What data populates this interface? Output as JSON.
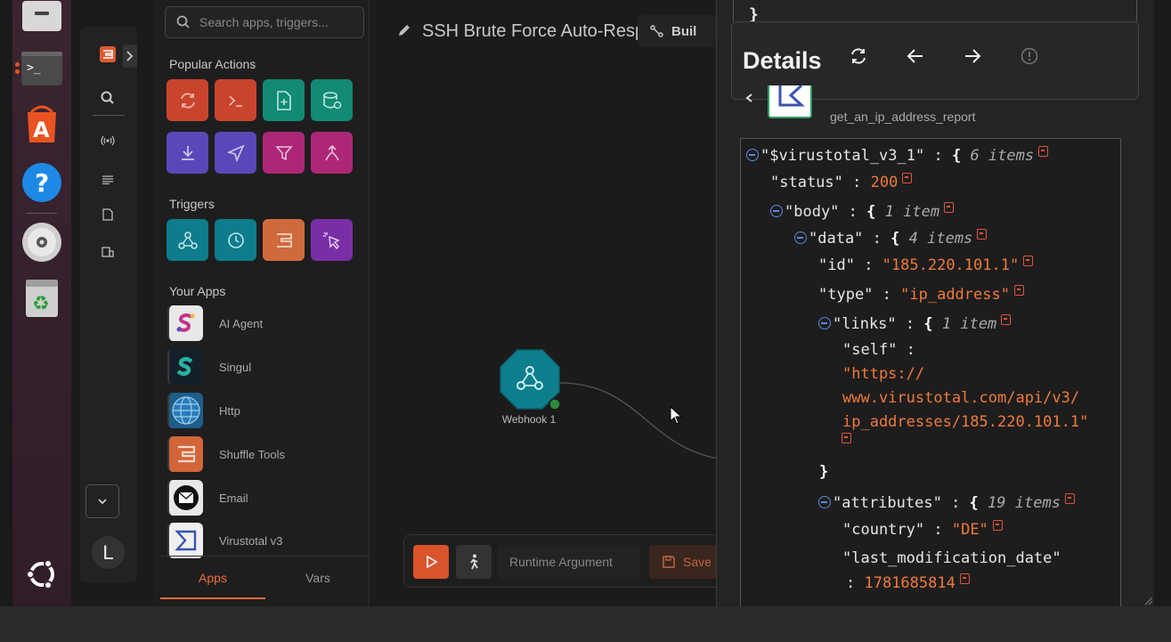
{
  "dock": {
    "apps": [
      {
        "name": "files-icon"
      },
      {
        "name": "terminal-icon",
        "label": ">_"
      },
      {
        "name": "app-center-icon"
      },
      {
        "name": "help-icon",
        "label": "?"
      },
      {
        "name": "disc-icon"
      },
      {
        "name": "trash-icon"
      },
      {
        "name": "ubuntu-logo-icon"
      }
    ]
  },
  "rail": {
    "avatar_letter": "L"
  },
  "apps_panel": {
    "search_placeholder": "Search apps, triggers...",
    "popular_actions_title": "Popular Actions",
    "triggers_title": "Triggers",
    "your_apps_title": "Your Apps",
    "apps": [
      {
        "name": "AI Agent"
      },
      {
        "name": "Singul"
      },
      {
        "name": "Http"
      },
      {
        "name": "Shuffle Tools"
      },
      {
        "name": "Email"
      },
      {
        "name": "Virustotal v3"
      }
    ],
    "tabs": {
      "apps": "Apps",
      "vars": "Vars"
    },
    "colors": {
      "red": "#d14a31",
      "teal": "#138a77",
      "purple": "#5a4bbd",
      "magenta": "#b0287a",
      "cyan": "#0e7d8c",
      "orange": "#d06a3a",
      "violet": "#7c2fa8"
    }
  },
  "canvas": {
    "workflow_title": "SSH Brute Force Auto-Resp",
    "build_label": "Buil",
    "node_label": "Webhook 1",
    "runtime_placeholder": "Runtime Argument",
    "save_label": "Save"
  },
  "details": {
    "title": "Details",
    "action_name": "get_an_ip_address_report",
    "json": {
      "root_key": "\"$virustotal_v3_1\"",
      "root_count": "6 items",
      "status_key": "\"status\"",
      "status_val": "200",
      "body_key": "\"body\"",
      "body_count": "1 item",
      "data_key": "\"data\"",
      "data_count": "4 items",
      "id_key": "\"id\"",
      "id_val": "\"185.220.101.1\"",
      "type_key": "\"type\"",
      "type_val": "\"ip_address\"",
      "links_key": "\"links\"",
      "links_count": "1 item",
      "self_key": "\"self\"",
      "self_val_1": "\"https://",
      "self_val_2": "www.virustotal.com/api/v3/",
      "self_val_3": "ip_addresses/185.220.101.1\"",
      "attr_key": "\"attributes\"",
      "attr_count": "19 items",
      "country_key": "\"country\"",
      "country_val": "\"DE\"",
      "lmd_key": "\"last_modification_date\"",
      "lmd_val": "1781685814"
    }
  }
}
